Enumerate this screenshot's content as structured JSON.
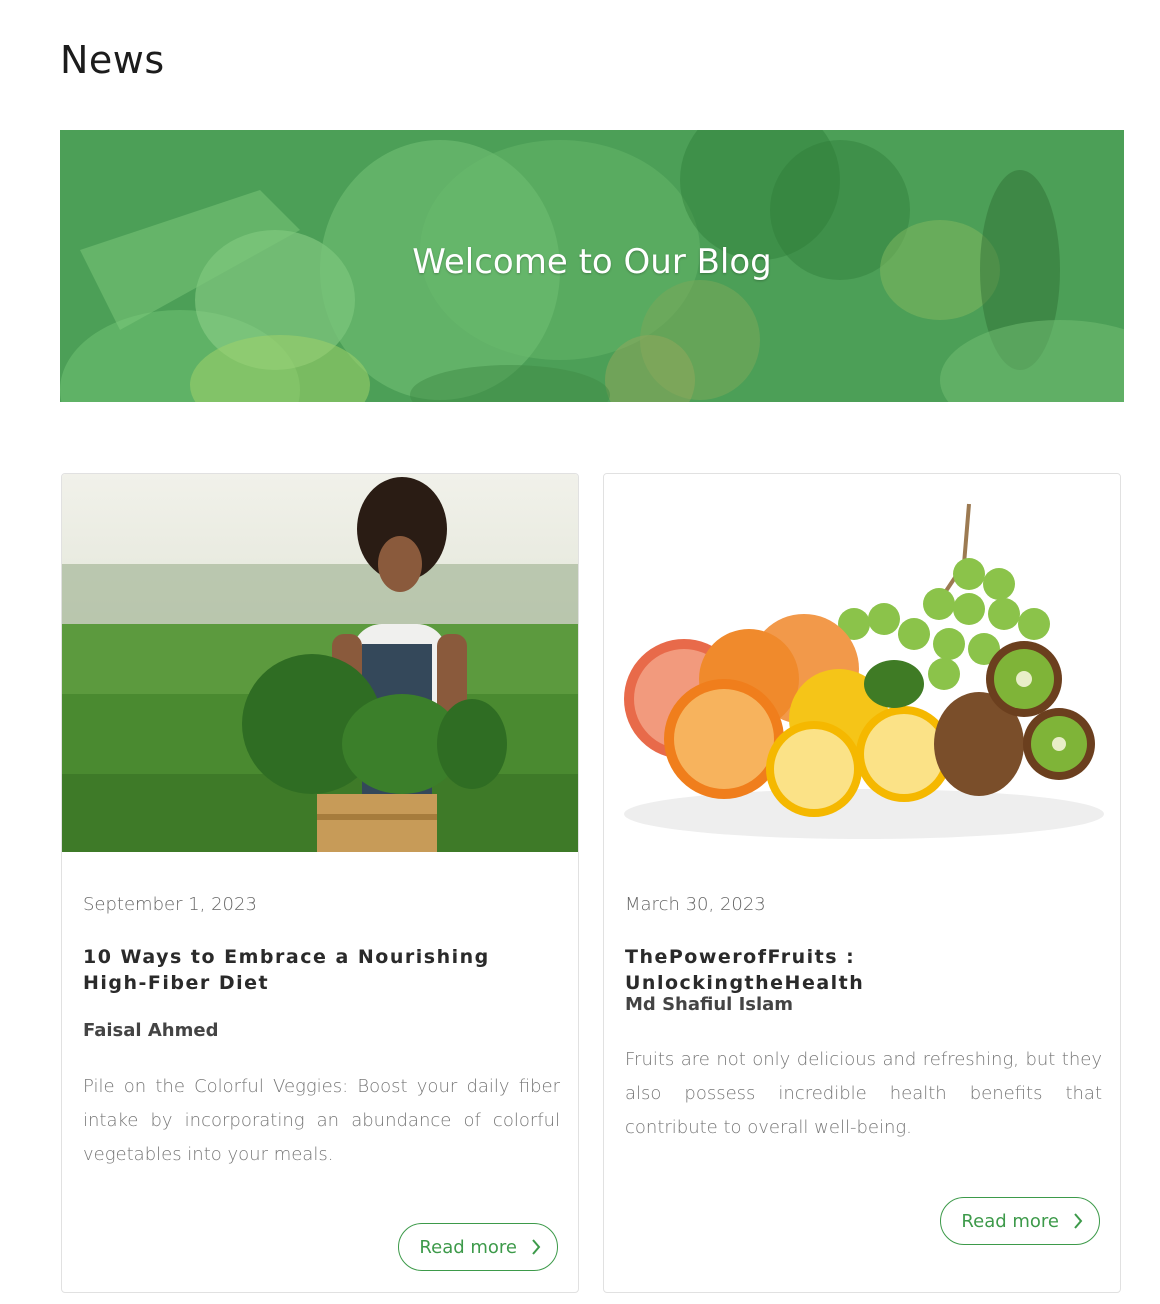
{
  "page": {
    "title": "News"
  },
  "banner": {
    "title": "Welcome to Our Blog",
    "overlay_color": "#4a9d55"
  },
  "posts": [
    {
      "date": "September 1, 2023",
      "title": "10 Ways to Embrace a Nourishing High-Fiber Diet",
      "author": "Faisal Ahmed",
      "excerpt": "Pile on the Colorful Veggies: Boost your daily fiber intake by incorporating an abundance of colorful vegetables into your meals.",
      "read_more_label": "Read more",
      "image": "woman-farmer-with-vegetables-image"
    },
    {
      "date": "March 30, 2023",
      "title": "ThePowerofFruits : UnlockingtheHealth",
      "author": "Md Shafiul Islam",
      "excerpt": "Fruits are not only delicious and refreshing, but they also possess incredible health benefits that contribute to overall well-being.",
      "read_more_label": "Read more",
      "image": "assorted-fruits-image"
    }
  ],
  "colors": {
    "accent": "#3d9a4a",
    "text_muted": "#777777"
  }
}
